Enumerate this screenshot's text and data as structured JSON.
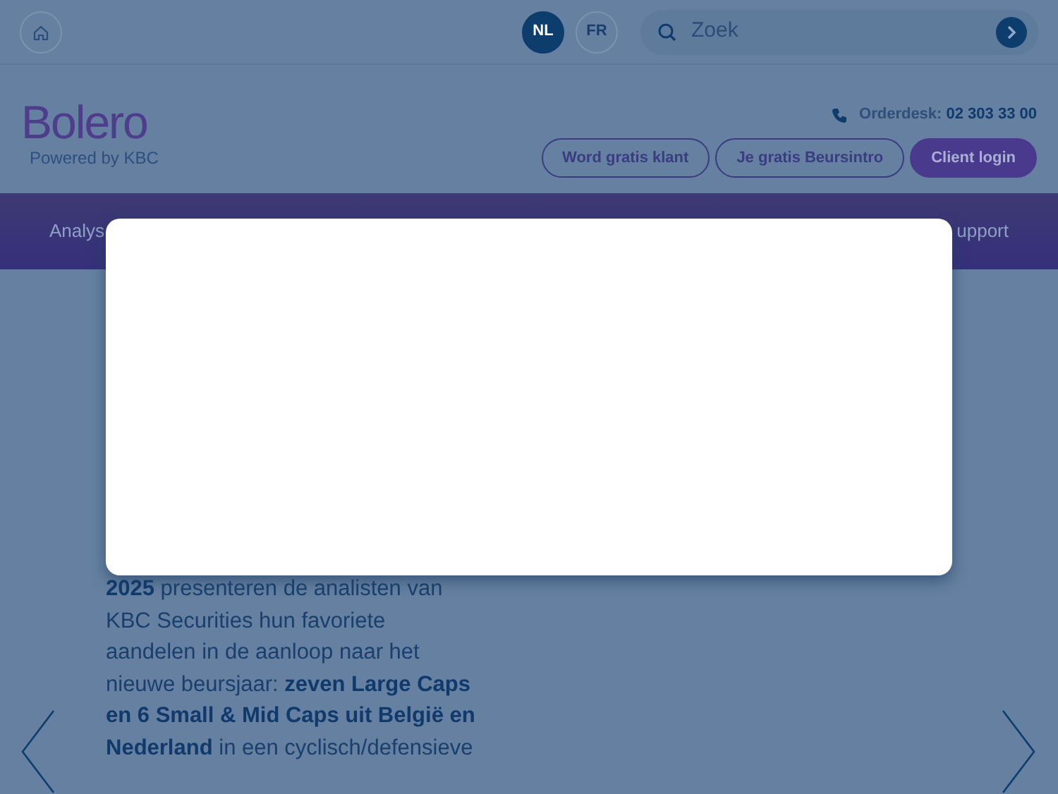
{
  "topbar": {
    "languages": [
      {
        "label": "NL",
        "selected": true
      },
      {
        "label": "FR",
        "selected": false
      }
    ],
    "search": {
      "placeholder": "Zoek"
    }
  },
  "header": {
    "logo": "Bolero",
    "tagline": "Powered by KBC",
    "orderdesk": {
      "label": "Orderdesk:",
      "phone": "02 303 33 00"
    },
    "buttons": [
      {
        "label": "Word gratis klant",
        "kind": "outline"
      },
      {
        "label": "Je gratis Beursintro",
        "kind": "outline"
      },
      {
        "label": "Client login",
        "kind": "filled"
      }
    ]
  },
  "nav": {
    "items": [
      "Analys",
      "upport"
    ]
  },
  "content": {
    "paragraph": "**2025** presenteren de analisten van KBC Securities hun favoriete aandelen in de aanloop naar het nieuwe beursjaar: **zeven Large Caps en 6 Small & Mid Caps uit België en Nederland** in een cyclisch/defensieve"
  },
  "dialog": {
    "open": true
  }
}
